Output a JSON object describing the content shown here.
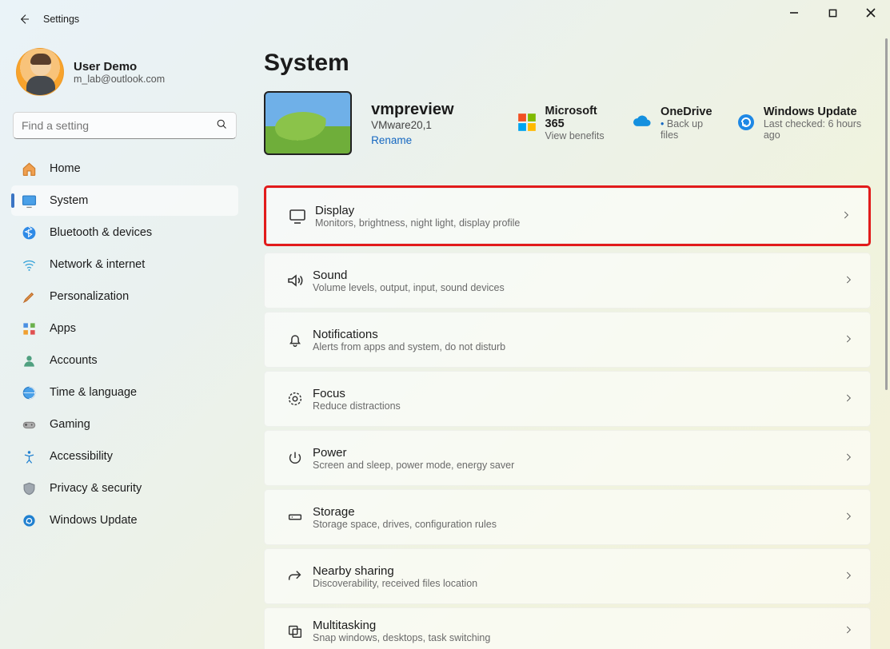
{
  "window": {
    "title": "Settings"
  },
  "profile": {
    "name": "User Demo",
    "email": "m_lab@outlook.com"
  },
  "search": {
    "placeholder": "Find a setting"
  },
  "nav": {
    "items": [
      {
        "label": "Home"
      },
      {
        "label": "System"
      },
      {
        "label": "Bluetooth & devices"
      },
      {
        "label": "Network & internet"
      },
      {
        "label": "Personalization"
      },
      {
        "label": "Apps"
      },
      {
        "label": "Accounts"
      },
      {
        "label": "Time & language"
      },
      {
        "label": "Gaming"
      },
      {
        "label": "Accessibility"
      },
      {
        "label": "Privacy & security"
      },
      {
        "label": "Windows Update"
      }
    ]
  },
  "page": {
    "title": "System",
    "device": {
      "name": "vmpreview",
      "model": "VMware20,1",
      "rename": "Rename"
    },
    "promos": [
      {
        "title": "Microsoft 365",
        "sub": "View benefits"
      },
      {
        "title": "OneDrive",
        "sub": "Back up files"
      },
      {
        "title": "Windows Update",
        "sub": "Last checked: 6 hours ago"
      }
    ],
    "settings": [
      {
        "title": "Display",
        "sub": "Monitors, brightness, night light, display profile"
      },
      {
        "title": "Sound",
        "sub": "Volume levels, output, input, sound devices"
      },
      {
        "title": "Notifications",
        "sub": "Alerts from apps and system, do not disturb"
      },
      {
        "title": "Focus",
        "sub": "Reduce distractions"
      },
      {
        "title": "Power",
        "sub": "Screen and sleep, power mode, energy saver"
      },
      {
        "title": "Storage",
        "sub": "Storage space, drives, configuration rules"
      },
      {
        "title": "Nearby sharing",
        "sub": "Discoverability, received files location"
      },
      {
        "title": "Multitasking",
        "sub": "Snap windows, desktops, task switching"
      }
    ]
  }
}
